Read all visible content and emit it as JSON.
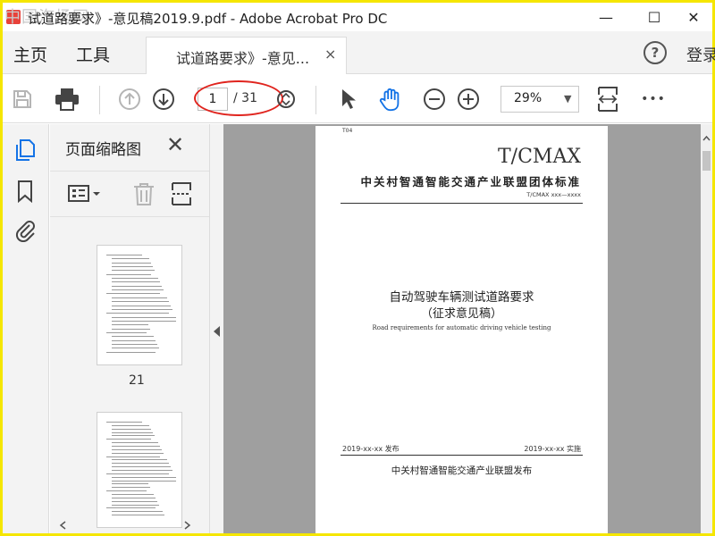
{
  "window": {
    "title": "试道路要求》-意见稿2019.9.pdf - Adobe Acrobat Pro DC",
    "watermark": "中国汽场网",
    "minimize": "—",
    "maximize": "☐",
    "close": "✕"
  },
  "menu": {
    "home": "主页",
    "tools": "工具",
    "tab_label": "试道路要求》-意见...",
    "tab_close": "×",
    "help": "?",
    "login": "登录"
  },
  "toolbar": {
    "current_page": "1",
    "total_pages": "/ 31",
    "zoom": "29%",
    "zoom_caret": "▼",
    "more": "•••"
  },
  "panel": {
    "title": "页面缩略图",
    "close": "✕",
    "thumb_label": "21"
  },
  "document": {
    "code": "T04",
    "tcmax": "T/CMAX",
    "org": "中关村智通智能交通产业联盟团体标准",
    "number": "T/CMAX xxx—xxxx",
    "title": "自动驾驶车辆测试道路要求",
    "subtitle": "（征求意见稿）",
    "english": "Road requirements for automatic driving vehicle testing",
    "publish": "2019-xx-xx 发布",
    "implement": "2019-xx-xx 实施",
    "issuer": "中关村智通智能交通产业联盟发布"
  },
  "colors": {
    "accent": "#1473e6",
    "frame": "#f5e600",
    "highlight": "#e0241e"
  }
}
